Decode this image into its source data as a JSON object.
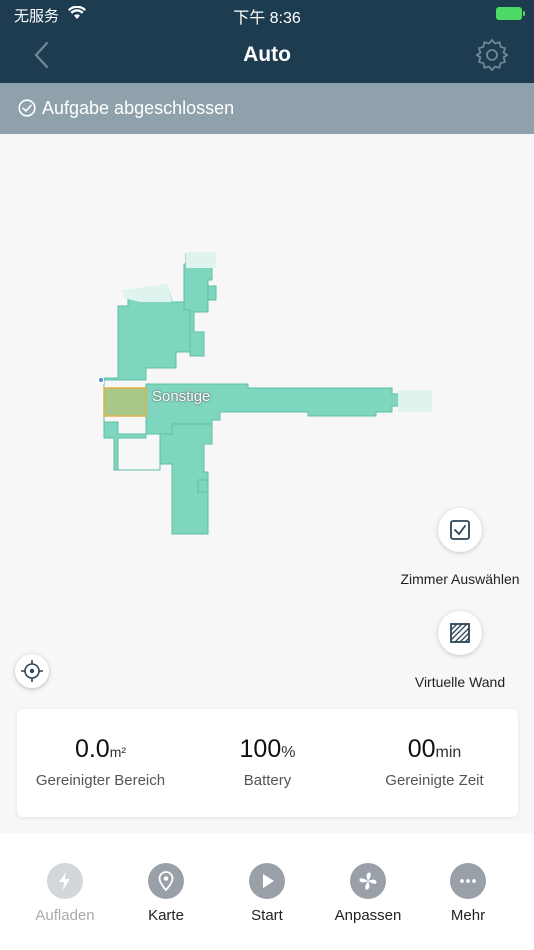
{
  "status": {
    "carrier": "无服务",
    "time": "下午 8:36"
  },
  "header": {
    "title": "Auto"
  },
  "banner": {
    "text": "Aufgabe abgeschlossen"
  },
  "map": {
    "room_label": "Sonstige",
    "floor_color": "#7fd6bf",
    "select_room_label": "Zimmer Auswählen",
    "virtual_wall_label": "Virtuelle Wand"
  },
  "stats": {
    "area": {
      "value": "0.0",
      "unit": "m²",
      "label": "Gereinigter Bereich"
    },
    "battery": {
      "value": "100",
      "unit": "%",
      "label": "Battery"
    },
    "time": {
      "value": "00",
      "unit": "min",
      "label": "Gereinigte Zeit"
    }
  },
  "tabs": [
    {
      "label": "Aufladen",
      "icon": "bolt-icon",
      "enabled": false
    },
    {
      "label": "Karte",
      "icon": "map-pin-icon",
      "enabled": true
    },
    {
      "label": "Start",
      "icon": "play-icon",
      "enabled": true
    },
    {
      "label": "Anpassen",
      "icon": "fan-icon",
      "enabled": true
    },
    {
      "label": "Mehr",
      "icon": "more-icon",
      "enabled": true
    }
  ],
  "colors": {
    "header_bg": "#1d3c50",
    "banner_bg": "#8fa2ab",
    "accent": "#7fd6bf"
  }
}
